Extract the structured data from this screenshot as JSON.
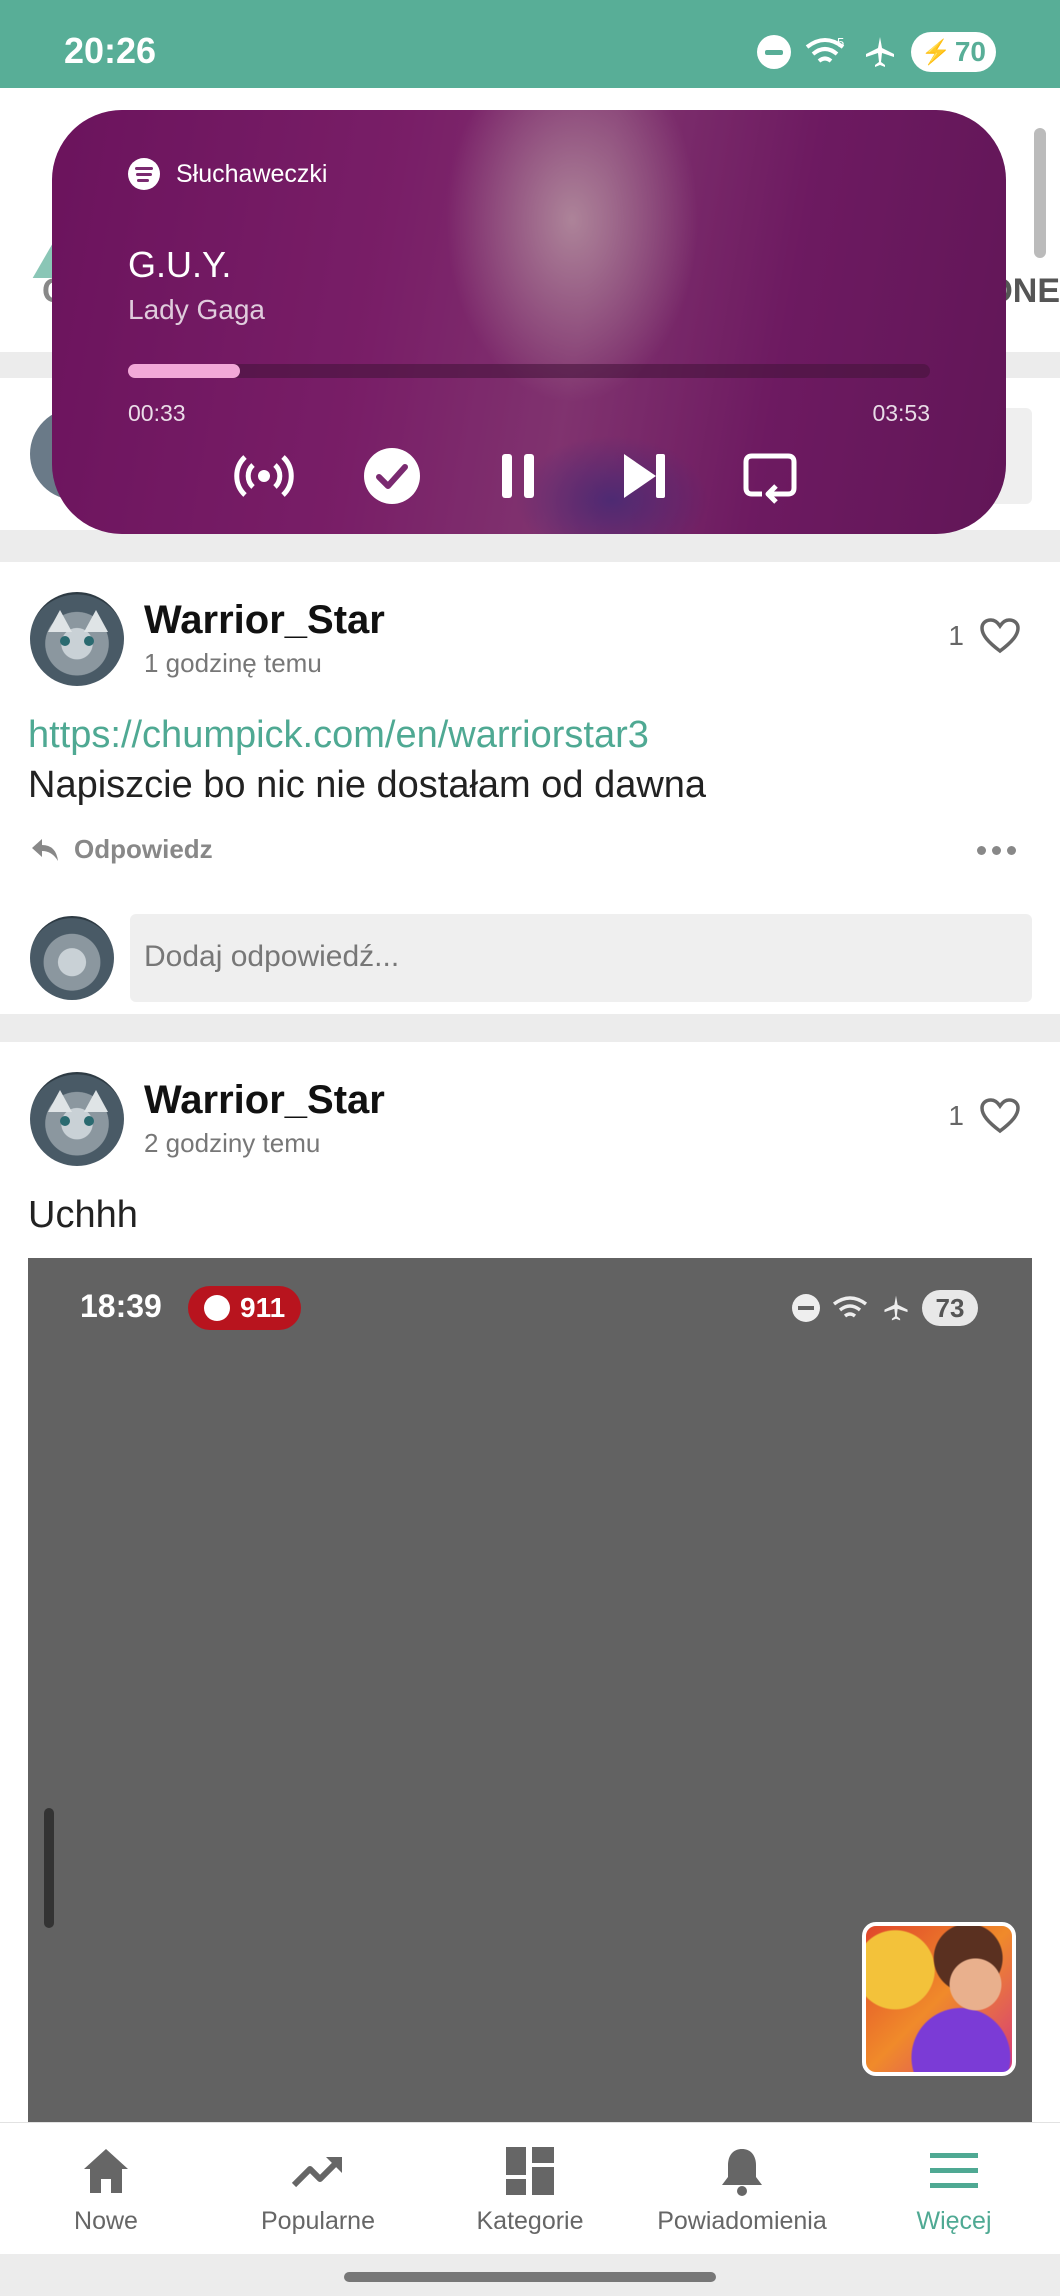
{
  "status_bar": {
    "time": "20:26",
    "battery": "70",
    "network_badge": "5"
  },
  "background_fragments": {
    "left_text": "C",
    "right_text": "ONE"
  },
  "media_player": {
    "output_device": "Słuchaweczki",
    "track_title": "G.U.Y.",
    "artist": "Lady Gaga",
    "elapsed": "00:33",
    "duration": "03:53",
    "progress": 0.14,
    "accent_color": "#f2a8d8",
    "controls": [
      "broadcast-icon",
      "saved-check-icon",
      "pause-icon",
      "skip-next-icon",
      "repeat-icon"
    ]
  },
  "posts": [
    {
      "username": "Warrior_Star",
      "time_ago": "1 godzinę temu",
      "likes": "1",
      "link": "https://chumpick.com/en/warriorstar3",
      "text": "Napiszcie bo nic nie dostałam od dawna",
      "reply_label": "Odpowiedz",
      "reply_placeholder": "Dodaj odpowiedź..."
    },
    {
      "username": "Warrior_Star",
      "time_ago": "2 godziny temu",
      "likes": "1",
      "text": "Uchhh",
      "embedded_screenshot": {
        "time": "18:39",
        "pill_text": "911",
        "battery": "73"
      }
    }
  ],
  "bottom_nav": [
    {
      "label": "Nowe",
      "icon": "home-icon"
    },
    {
      "label": "Popularne",
      "icon": "trending-icon"
    },
    {
      "label": "Kategorie",
      "icon": "categories-icon"
    },
    {
      "label": "Powiadomienia",
      "icon": "bell-icon"
    },
    {
      "label": "Więcej",
      "icon": "menu-icon",
      "active": true
    }
  ],
  "colors": {
    "brand": "#58ae97",
    "link": "#4fa993"
  }
}
